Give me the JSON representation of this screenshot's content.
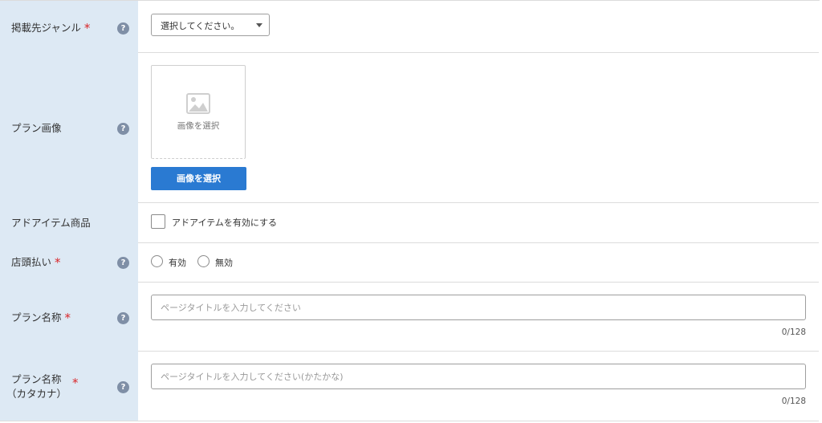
{
  "rows": {
    "genre": {
      "label": "掲載先ジャンル",
      "required_mark": "*",
      "help": "?",
      "select_value": "選択してください。"
    },
    "image": {
      "label": "プラン画像",
      "help": "?",
      "placeholder_label": "画像を選択",
      "button_label": "画像を選択"
    },
    "ad_item": {
      "label": "アドアイテム商品",
      "checkbox_label": "アドアイテムを有効にする"
    },
    "store_payment": {
      "label": "店頭払い",
      "required_mark": "*",
      "help": "?",
      "options": [
        "有効",
        "無効"
      ]
    },
    "plan_name": {
      "label": "プラン名称",
      "required_mark": "*",
      "help": "?",
      "placeholder": "ページタイトルを入力してください",
      "counter": "0/128"
    },
    "plan_name_kana": {
      "label_line1": "プラン名称",
      "label_line2": "（カタカナ）",
      "required_mark": "*",
      "help": "?",
      "placeholder": "ページタイトルを入力してください(かたかな)",
      "counter": "0/128"
    }
  },
  "icons": {
    "help": "question-circle-icon",
    "image": "image-placeholder-icon",
    "caret": "chevron-down-icon"
  },
  "colors": {
    "label_bg": "#dde9f4",
    "required": "#d9272a",
    "help_bg": "#7f8fa6",
    "button_bg": "#2a7ad2"
  }
}
